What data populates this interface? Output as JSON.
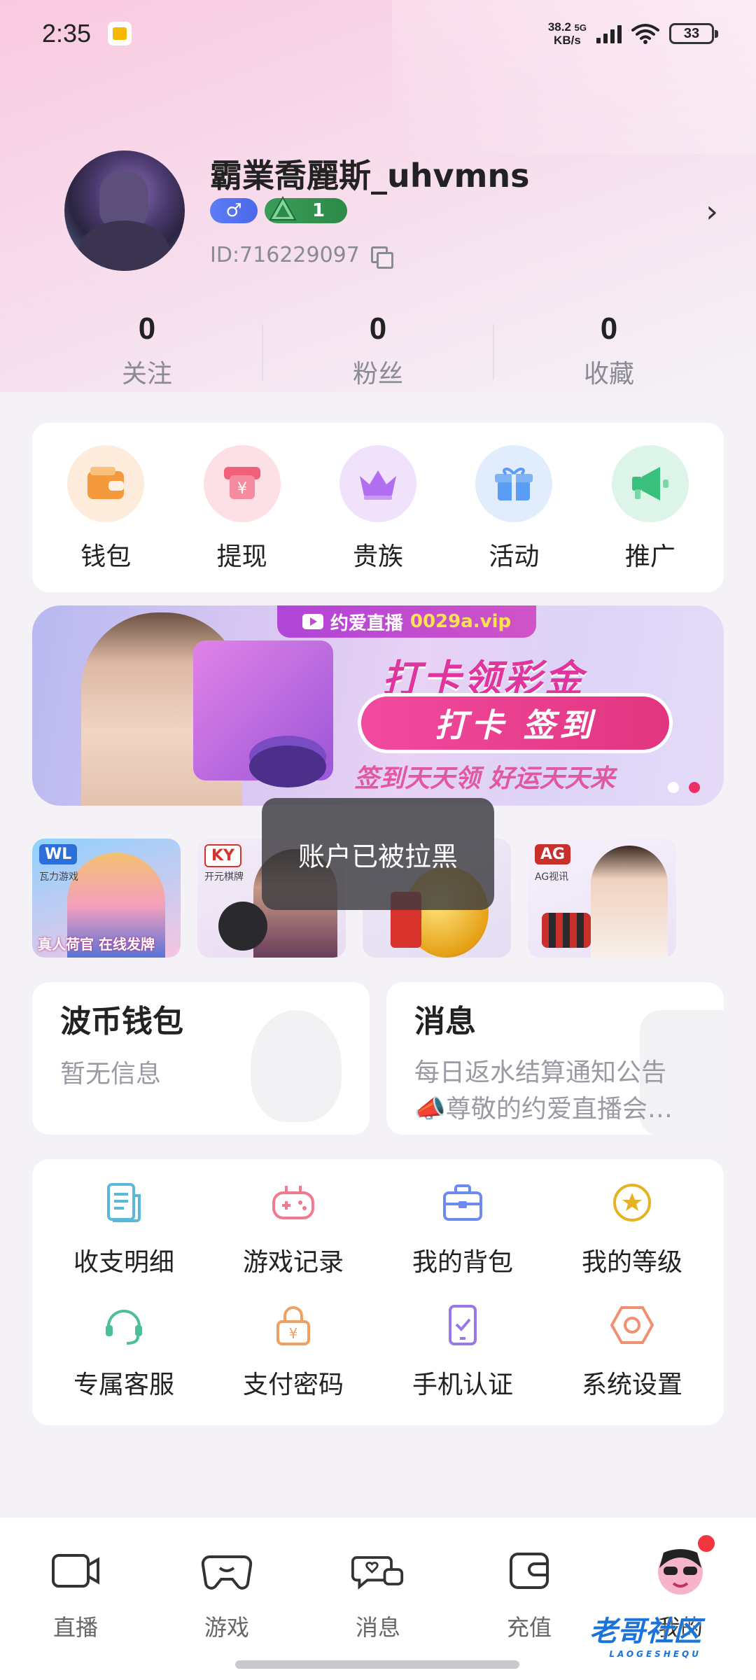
{
  "status_bar": {
    "time": "2:35",
    "net_speed": "38.2",
    "net_unit": "KB/s",
    "net_type": "5G",
    "battery": "33"
  },
  "profile": {
    "username": "霸業喬麗斯_uhvmns",
    "gender_symbol": "♂",
    "level": "1",
    "user_id": "ID:716229097",
    "chevron": "›"
  },
  "stats": [
    {
      "value": "0",
      "label": "关注"
    },
    {
      "value": "0",
      "label": "粉丝"
    },
    {
      "value": "0",
      "label": "收藏"
    }
  ],
  "quick_actions": [
    {
      "label": "钱包",
      "icon": "wallet-icon",
      "color": "#f59a3c",
      "bg": "#fdecdc"
    },
    {
      "label": "提现",
      "icon": "withdraw-icon",
      "color": "#f0607a",
      "bg": "#fde0e6"
    },
    {
      "label": "贵族",
      "icon": "crown-icon",
      "color": "#b26ef0",
      "bg": "#f1e2fc"
    },
    {
      "label": "活动",
      "icon": "gift-icon",
      "color": "#5b9cf5",
      "bg": "#e1ecfd"
    },
    {
      "label": "推广",
      "icon": "megaphone-icon",
      "color": "#39c07c",
      "bg": "#ddf5e8"
    }
  ],
  "banner": {
    "tagline_prefix": "约爱直播",
    "tagline_site": "0029a.vip",
    "title": "打卡领彩金",
    "pill": "打卡 签到",
    "slogan": "签到天天领 好运天天来",
    "dots_total": 2,
    "dots_active": 2
  },
  "games": [
    {
      "logo": "WL",
      "sub": "瓦力游戏",
      "footer": "真人荷官 在线发牌",
      "accent": "#2d6fd8"
    },
    {
      "logo": "KY",
      "sub": "开元棋牌",
      "footer": "",
      "accent": "#d8322d"
    },
    {
      "logo": "",
      "sub": "",
      "footer": "",
      "accent": "#e5a117"
    },
    {
      "logo": "AG",
      "sub": "AG视讯",
      "footer": "",
      "accent": "#c9302c"
    }
  ],
  "toast": "账户已被拉黑",
  "wallet_card": {
    "title": "波币钱包",
    "text": "暂无信息"
  },
  "message_card": {
    "title": "消息",
    "line1": "每日返水结算通知公告",
    "line2": "📣尊敬的约爱直播会…"
  },
  "tools": [
    {
      "label": "收支明细",
      "icon": "document-icon",
      "color": "#5ab9d8"
    },
    {
      "label": "游戏记录",
      "icon": "gamepad-icon",
      "color": "#f07a90"
    },
    {
      "label": "我的背包",
      "icon": "briefcase-icon",
      "color": "#6b8bf0"
    },
    {
      "label": "我的等级",
      "icon": "star-badge-icon",
      "color": "#e5b224"
    },
    {
      "label": "专属客服",
      "icon": "headset-icon",
      "color": "#4cc095"
    },
    {
      "label": "支付密码",
      "icon": "lock-icon",
      "color": "#f0a060"
    },
    {
      "label": "手机认证",
      "icon": "phone-check-icon",
      "color": "#9a78e8"
    },
    {
      "label": "系统设置",
      "icon": "hexagon-settings-icon",
      "color": "#f09070"
    }
  ],
  "tabs": [
    {
      "label": "直播",
      "icon": "tv-icon"
    },
    {
      "label": "游戏",
      "icon": "gamepad-icon"
    },
    {
      "label": "消息",
      "icon": "chat-heart-icon"
    },
    {
      "label": "充值",
      "icon": "wallet-icon"
    },
    {
      "label": "我的",
      "icon": "avatar-icon",
      "active": true
    }
  ],
  "watermark": {
    "text": "老哥社区",
    "sub": "LAOGESHEQU"
  }
}
